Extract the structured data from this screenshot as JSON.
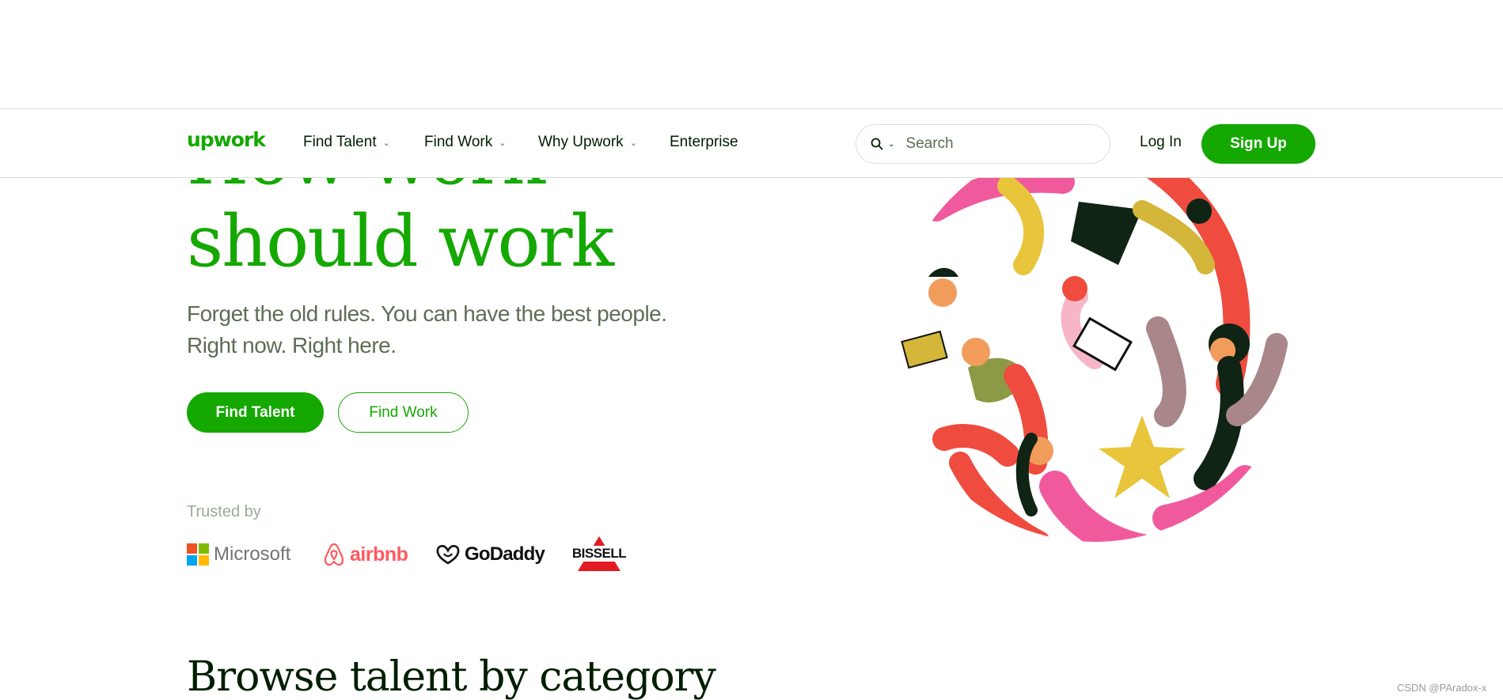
{
  "hero": {
    "headline_line1": "How work",
    "headline_line2": "should work",
    "subtitle_line1": "Forget the old rules. You can have the best people.",
    "subtitle_line2": "Right now. Right here.",
    "cta_primary": "Find Talent",
    "cta_secondary": "Find Work",
    "illustration": "people-collaborating-circle-illustration"
  },
  "nav": {
    "logo": "upwork",
    "items": [
      {
        "label": "Find Talent",
        "has_dropdown": true
      },
      {
        "label": "Find Work",
        "has_dropdown": true
      },
      {
        "label": "Why Upwork",
        "has_dropdown": true
      },
      {
        "label": "Enterprise",
        "has_dropdown": false
      }
    ],
    "search_placeholder": "Search",
    "search_icon": "search-icon",
    "login": "Log In",
    "signup": "Sign Up"
  },
  "trusted": {
    "label": "Trusted by",
    "brands": [
      "Microsoft",
      "airbnb",
      "GoDaddy",
      "BISSELL"
    ]
  },
  "section_title": "Browse talent by category",
  "watermark": "CSDN @PAradox-x",
  "colors": {
    "brand_green": "#14a800",
    "text_dark": "#001e00",
    "text_muted": "#5e6d55",
    "border": "#d5e0d5"
  }
}
